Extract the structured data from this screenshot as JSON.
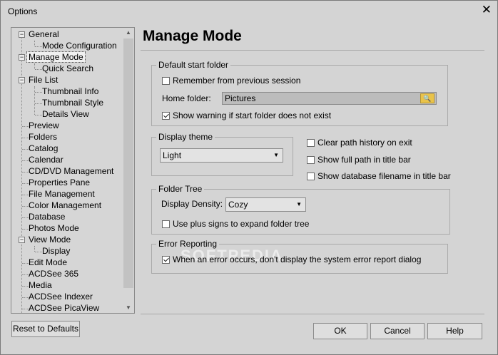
{
  "window": {
    "title": "Options"
  },
  "tree": {
    "items": [
      {
        "label": "General"
      },
      {
        "label": "Mode Configuration"
      },
      {
        "label": "Manage Mode"
      },
      {
        "label": "Quick Search"
      },
      {
        "label": "File List"
      },
      {
        "label": "Thumbnail Info"
      },
      {
        "label": "Thumbnail Style"
      },
      {
        "label": "Details View"
      },
      {
        "label": "Preview"
      },
      {
        "label": "Folders"
      },
      {
        "label": "Catalog"
      },
      {
        "label": "Calendar"
      },
      {
        "label": "CD/DVD Management"
      },
      {
        "label": "Properties Pane"
      },
      {
        "label": "File Management"
      },
      {
        "label": "Color Management"
      },
      {
        "label": "Database"
      },
      {
        "label": "Photos Mode"
      },
      {
        "label": "View Mode"
      },
      {
        "label": "Display"
      },
      {
        "label": "Edit Mode"
      },
      {
        "label": "ACDSee 365"
      },
      {
        "label": "Media"
      },
      {
        "label": "ACDSee Indexer"
      },
      {
        "label": "ACDSee PicaView"
      }
    ]
  },
  "page": {
    "title": "Manage Mode"
  },
  "default_start_folder": {
    "label": "Default start folder",
    "remember": "Remember from previous session",
    "home_label": "Home folder:",
    "home_value": "Pictures",
    "show_warning": "Show warning if start folder does not exist"
  },
  "display_theme": {
    "label": "Display theme",
    "value": "Light"
  },
  "options": {
    "clear_history": "Clear path history on exit",
    "full_path": "Show full path in title bar",
    "db_filename": "Show database filename in title bar"
  },
  "folder_tree": {
    "label": "Folder Tree",
    "density_label": "Display Density:",
    "density_value": "Cozy",
    "plus_signs": "Use plus signs to expand folder tree"
  },
  "error_reporting": {
    "label": "Error Reporting",
    "text": "When an error occurs, don't display the system error report dialog"
  },
  "buttons": {
    "reset": "Reset to Defaults",
    "ok": "OK",
    "cancel": "Cancel",
    "help": "Help"
  },
  "watermark": "SOFTPEDIA"
}
